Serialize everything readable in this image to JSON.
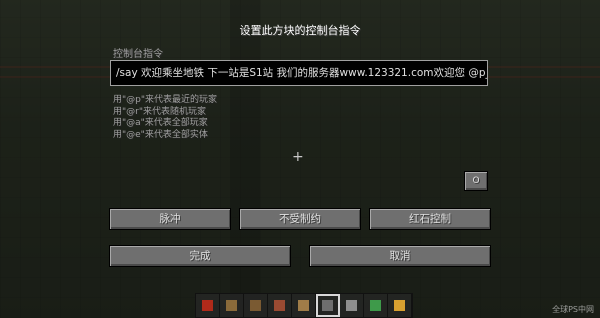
{
  "dialog": {
    "title": "设置此方块的控制台指令",
    "field_label": "控制台指令",
    "command_value": "/say 欢迎乘坐地铁 下一站是S1站 我们的服务器www.123321.com欢迎您 @p_",
    "help_lines": [
      "用\"@p\"来代表最近的玩家",
      "用\"@r\"来代表随机玩家",
      "用\"@a\"来代表全部玩家",
      "用\"@e\"来代表全部实体"
    ],
    "output_toggle_label": "O",
    "mode_buttons": [
      "脉冲",
      "不受制约",
      "红石控制"
    ],
    "done_label": "完成",
    "cancel_label": "取消"
  },
  "hotbar": {
    "slots": [
      {
        "icon": "redstone-torch-icon",
        "color": "#b02a1a"
      },
      {
        "icon": "rail-icon",
        "color": "#8a6a3a"
      },
      {
        "icon": "stick-icon",
        "color": "#7a5a32"
      },
      {
        "icon": "brick-icon",
        "color": "#9a4a32"
      },
      {
        "icon": "wood-plank-icon",
        "color": "#a07c48"
      },
      {
        "icon": "minecart-icon",
        "color": "#6e6e6e"
      },
      {
        "icon": "slab-icon",
        "color": "#8e8e8e"
      },
      {
        "icon": "emerald-block-icon",
        "color": "#3e9a4a"
      },
      {
        "icon": "torch-icon",
        "color": "#d8a030"
      }
    ],
    "selected_index": 5
  },
  "watermark": "全球PS中网"
}
